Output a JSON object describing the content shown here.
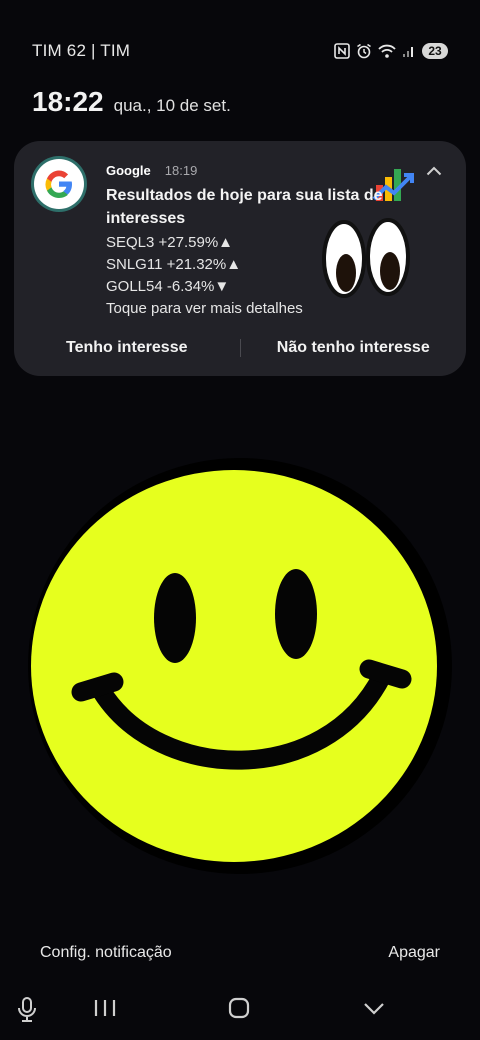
{
  "status_bar": {
    "carrier": "TIM 62 | TIM",
    "icons": [
      "nfc-icon",
      "alarm-icon",
      "wifi-icon",
      "signal-icon"
    ],
    "battery": "23"
  },
  "lockscreen": {
    "time": "18:22",
    "date": "qua., 10 de set."
  },
  "notification": {
    "app_name": "Google",
    "time": "18:19",
    "title": "Resultados de hoje para sua lista de interesses",
    "lines": [
      "SEQL3 +27.59%▲",
      "SNLG11 +21.32%▲",
      "GOLL54 -6.34%▼",
      "Toque para ver mais detalhes"
    ],
    "actions": {
      "interested": "Tenho interesse",
      "not_interested": "Não tenho interesse"
    },
    "colors": {
      "background": "#222228",
      "accent_ring": "#2e6f6a"
    }
  },
  "smiley": {
    "face_color": "#e6ff1e",
    "feature_color": "#050505"
  },
  "bottom": {
    "settings_link": "Config. notificação",
    "clear_link": "Apagar"
  },
  "navigation": [
    "mic-icon",
    "recent-apps-icon",
    "home-icon",
    "back-icon"
  ]
}
